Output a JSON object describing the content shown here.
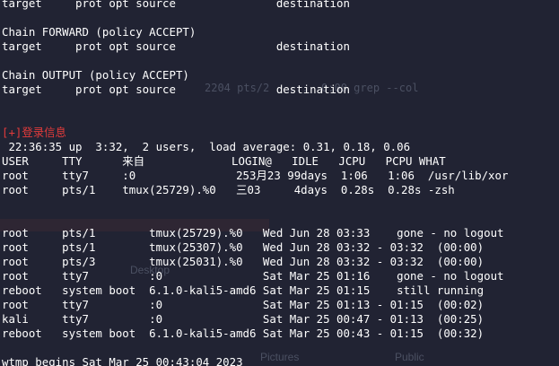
{
  "terminal": {
    "lines": [
      {
        "text": "target     prot opt source               destination",
        "color": "#ffffff"
      },
      {
        "text": "",
        "color": "#ffffff"
      },
      {
        "text": "Chain FORWARD (policy ACCEPT)",
        "color": "#ffffff"
      },
      {
        "text": "target     prot opt source               destination",
        "color": "#ffffff"
      },
      {
        "text": "",
        "color": "#ffffff"
      },
      {
        "text": "Chain OUTPUT (policy ACCEPT)",
        "color": "#ffffff"
      },
      {
        "text": "target     prot opt source               destination",
        "color": "#ffffff"
      },
      {
        "text": "",
        "color": "#ffffff"
      },
      {
        "text": "",
        "color": "#ffffff"
      },
      {
        "text": "[+]登录信息",
        "color": "#e23b3b"
      },
      {
        "text": " 22:36:35 up  3:32,  2 users,  load average: 0.31, 0.18, 0.06",
        "color": "#ffffff"
      },
      {
        "text": "USER     TTY      来自             LOGIN@   IDLE   JCPU   PCPU WHAT",
        "color": "#ffffff"
      },
      {
        "text": "root     tty7     :0               253月23 99days  1:06   1:06  /usr/lib/xor",
        "color": "#ffffff"
      },
      {
        "text": "root     pts/1    tmux(25729).%0   三03     4days  0.28s  0.28s -zsh",
        "color": "#ffffff"
      },
      {
        "text": "",
        "color": "#ffffff"
      },
      {
        "text": "",
        "color": "#ffffff"
      },
      {
        "text": "root     pts/1        tmux(25729).%0   Wed Jun 28 03:33    gone - no logout",
        "color": "#ffffff"
      },
      {
        "text": "root     pts/1        tmux(25307).%0   Wed Jun 28 03:32 - 03:32  (00:00)",
        "color": "#ffffff"
      },
      {
        "text": "root     pts/3        tmux(25031).%0   Wed Jun 28 03:32 - 03:32  (00:00)",
        "color": "#ffffff"
      },
      {
        "text": "root     tty7         :0               Sat Mar 25 01:16    gone - no logout",
        "color": "#ffffff"
      },
      {
        "text": "reboot   system boot  6.1.0-kali5-amd6 Sat Mar 25 01:15    still running",
        "color": "#ffffff"
      },
      {
        "text": "root     tty7         :0               Sat Mar 25 01:13 - 01:15  (00:02)",
        "color": "#ffffff"
      },
      {
        "text": "kali     tty7         :0               Sat Mar 25 00:47 - 01:13  (00:25)",
        "color": "#ffffff"
      },
      {
        "text": "reboot   system boot  6.1.0-kali5-amd6 Sat Mar 25 00:43 - 01:15  (00:32)",
        "color": "#ffffff"
      },
      {
        "text": "",
        "color": "#ffffff"
      },
      {
        "text": "wtmp begins Sat Mar 25 00:43:04 2023",
        "color": "#ffffff"
      }
    ]
  },
  "background_ghosts": {
    "ps_fragment": "2204 pts/2   ...  0:00 grep --col",
    "desktop_label": "Desktop",
    "pictures_label": "Pictures",
    "public_label": "Public"
  },
  "colors": {
    "background": "#212333",
    "text": "#ffffff",
    "accent_red": "#e23b3b"
  }
}
